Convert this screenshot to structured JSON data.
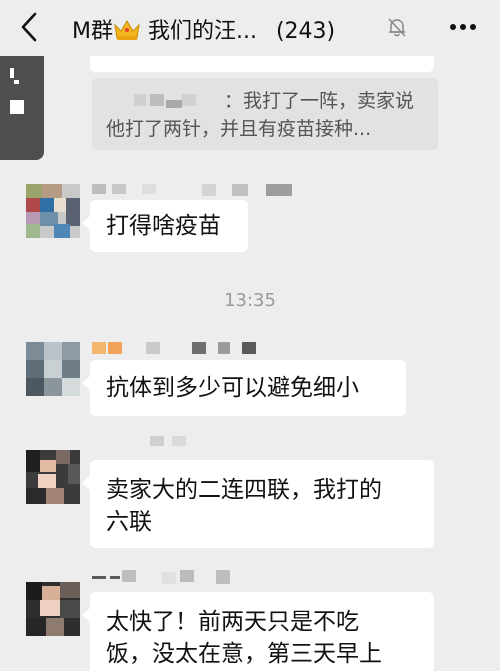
{
  "header": {
    "title": "M群",
    "title_rest": "我们的汪...",
    "count": "(243)"
  },
  "quote": {
    "line1": "：我打了一阵，卖家说",
    "line2": "他打了两针，并且有疫苗接种..."
  },
  "timestamp": "13:35",
  "messages": [
    {
      "text": "打得啥疫苗"
    },
    {
      "text": "抗体到多少可以避免细小"
    },
    {
      "line1": "卖家大的二连四联，我打的",
      "line2": "六联"
    },
    {
      "line1": "太快了！前两天只是不吃",
      "line2": "饭，没太在意，第三天早上"
    }
  ],
  "icons": {
    "back": "chevron-left-icon",
    "crown": "crown-emoji-icon",
    "mute": "bell-off-icon",
    "more": "more-dots-icon"
  }
}
